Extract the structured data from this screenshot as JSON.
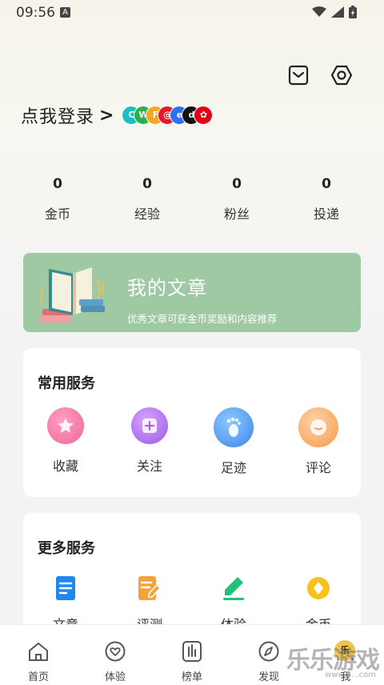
{
  "status": {
    "time": "09:56",
    "indicator": "A"
  },
  "header": {
    "mail_icon": "mail-icon",
    "settings_icon": "settings-icon"
  },
  "login": {
    "label": "点我登录",
    "arrow": ">",
    "providers": [
      {
        "name": "provider-1",
        "color": "#19c0c0",
        "glyph": "C"
      },
      {
        "name": "wechat",
        "color": "#2bb24c",
        "glyph": "W"
      },
      {
        "name": "provider-3",
        "color": "#f5a623",
        "glyph": "F"
      },
      {
        "name": "weibo",
        "color": "#e6162d",
        "glyph": "@"
      },
      {
        "name": "provider-5",
        "color": "#2f6ff2",
        "glyph": "e"
      },
      {
        "name": "douyin",
        "color": "#111111",
        "glyph": "d"
      },
      {
        "name": "huawei",
        "color": "#e60012",
        "glyph": "✿"
      }
    ]
  },
  "stats": [
    {
      "value": "0",
      "label": "金币"
    },
    {
      "value": "0",
      "label": "经验"
    },
    {
      "value": "0",
      "label": "粉丝"
    },
    {
      "value": "0",
      "label": "投递"
    }
  ],
  "banner": {
    "title": "我的文章",
    "subtitle": "优秀文章可获金币奖励和内容推荐"
  },
  "common_services": {
    "title": "常用服务",
    "items": [
      {
        "label": "收藏",
        "icon": "star-icon"
      },
      {
        "label": "关注",
        "icon": "plus-icon"
      },
      {
        "label": "足迹",
        "icon": "footprint-icon"
      },
      {
        "label": "评论",
        "icon": "comment-icon"
      }
    ]
  },
  "more_services": {
    "title": "更多服务",
    "items": [
      {
        "label": "文章",
        "icon": "article-icon"
      },
      {
        "label": "评测",
        "icon": "review-icon"
      },
      {
        "label": "体验",
        "icon": "pen-icon"
      },
      {
        "label": "金币",
        "icon": "coin-icon"
      }
    ]
  },
  "tabs": [
    {
      "label": "首页",
      "icon": "home-icon"
    },
    {
      "label": "体验",
      "icon": "heart-icon"
    },
    {
      "label": "榜单",
      "icon": "ranking-icon"
    },
    {
      "label": "发现",
      "icon": "compass-icon"
    },
    {
      "label": "我",
      "icon": "profile-icon"
    }
  ],
  "watermark": {
    "text": "乐乐游戏",
    "url": "www.6...com"
  }
}
